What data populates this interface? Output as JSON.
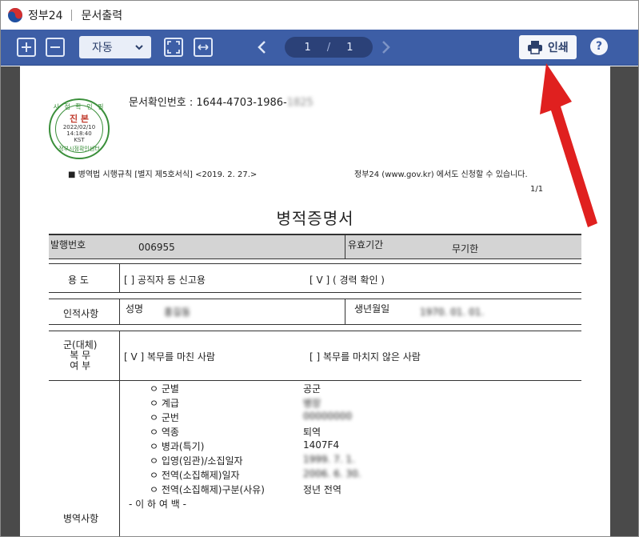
{
  "titlebar": {
    "app_name": "정부24",
    "doc_title": "문서출력"
  },
  "toolbar": {
    "zoom_value": "자동",
    "current_page": "1",
    "page_separator": "/",
    "total_pages": "1",
    "print_label": "인쇄",
    "help_label": "?"
  },
  "document": {
    "doc_no_label": "문서확인번호 : 1644-4703-1986-",
    "doc_no_hidden": "1825",
    "seal": {
      "top": "시 점 확 인 필",
      "main": "진 본",
      "date": "2022/02/10",
      "time": "14:18:40",
      "tz": "KST",
      "bottom": "정부시점확인센터"
    },
    "form_ref": "■ 병역법 시행규칙 [별지 제5호서식] <2019. 2. 27.>",
    "form_ref_right": "정부24 (www.gov.kr) 에서도 신청할 수 있습니다.",
    "page_no": "1/1",
    "heading": "병적증명서",
    "issue_no_label": "발행번호",
    "issue_no": "006955",
    "valid_label": "유효기간",
    "valid_value": "무기한",
    "purpose_label": "용   도",
    "purpose_opt1": "[      ] 공직자 등 신고용",
    "purpose_opt2": "[  V  ] ( 경력 확인 )",
    "person_label": "인적사항",
    "name_label": "성명",
    "name_value": "홍길동",
    "birth_label": "생년월일",
    "birth_value": "1970. 01. 01.",
    "service_label_1": "군(대체)",
    "service_label_2": "복   무",
    "service_label_3": "여   부",
    "service_opt1": "[  V  ] 복무를 마친 사람",
    "service_opt2": "[      ] 복무를 마치지 않은 사람",
    "record_label": "병역사항",
    "records": [
      {
        "label": "ㅇ 군별",
        "value": "공군",
        "hidden": false
      },
      {
        "label": "ㅇ 계급",
        "value": "병장",
        "hidden": true
      },
      {
        "label": "ㅇ 군번",
        "value": "00000000",
        "hidden": true
      },
      {
        "label": "ㅇ 역종",
        "value": "퇴역",
        "hidden": false
      },
      {
        "label": "ㅇ 병과(특기)",
        "value": "1407F4",
        "hidden": false
      },
      {
        "label": "ㅇ 입영(임관)/소집일자",
        "value": "1999. 7. 1.",
        "hidden": true
      },
      {
        "label": "ㅇ 전역(소집해제)일자",
        "value": "2006. 6. 30.",
        "hidden": true
      },
      {
        "label": "ㅇ 전역(소집해제)구분(사유)",
        "value": "정년 전역",
        "hidden": false
      }
    ],
    "end_mark": "- 이 하 여 백 -"
  }
}
